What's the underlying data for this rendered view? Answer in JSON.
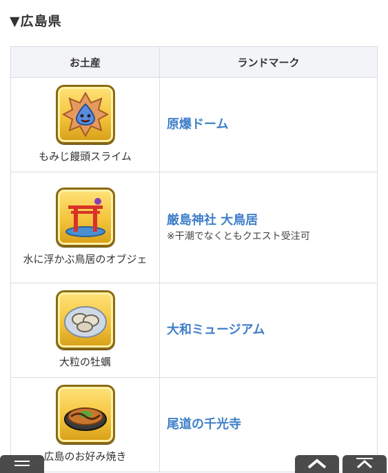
{
  "page": {
    "heading": "▼広島県"
  },
  "table": {
    "headers": {
      "souvenir": "お土産",
      "landmark": "ランドマーク"
    },
    "rows": [
      {
        "souvenir": "もみじ饅頭スライム",
        "landmark": "原爆ドーム",
        "note": "",
        "icon": "momiji-manju-slime-icon"
      },
      {
        "souvenir": "水に浮かぶ鳥居のオブジェ",
        "landmark": "厳島神社 大鳥居",
        "note": "※干潮でなくともクエスト受注可",
        "icon": "floating-torii-icon"
      },
      {
        "souvenir": "大粒の牡蠣",
        "landmark": "大和ミュージアム",
        "note": "",
        "icon": "oyster-plate-icon"
      },
      {
        "souvenir": "広島のお好み焼き",
        "landmark": "尾道の千光寺",
        "note": "",
        "icon": "okonomiyaki-icon"
      }
    ]
  },
  "nav": {
    "menu": "menu-icon",
    "up": "chevron-up-icon",
    "top": "scroll-top-icon"
  },
  "colors": {
    "accent": "#3f7fc9",
    "icon_frame": "#f4c43a",
    "header_bg": "#f3f4f7"
  }
}
